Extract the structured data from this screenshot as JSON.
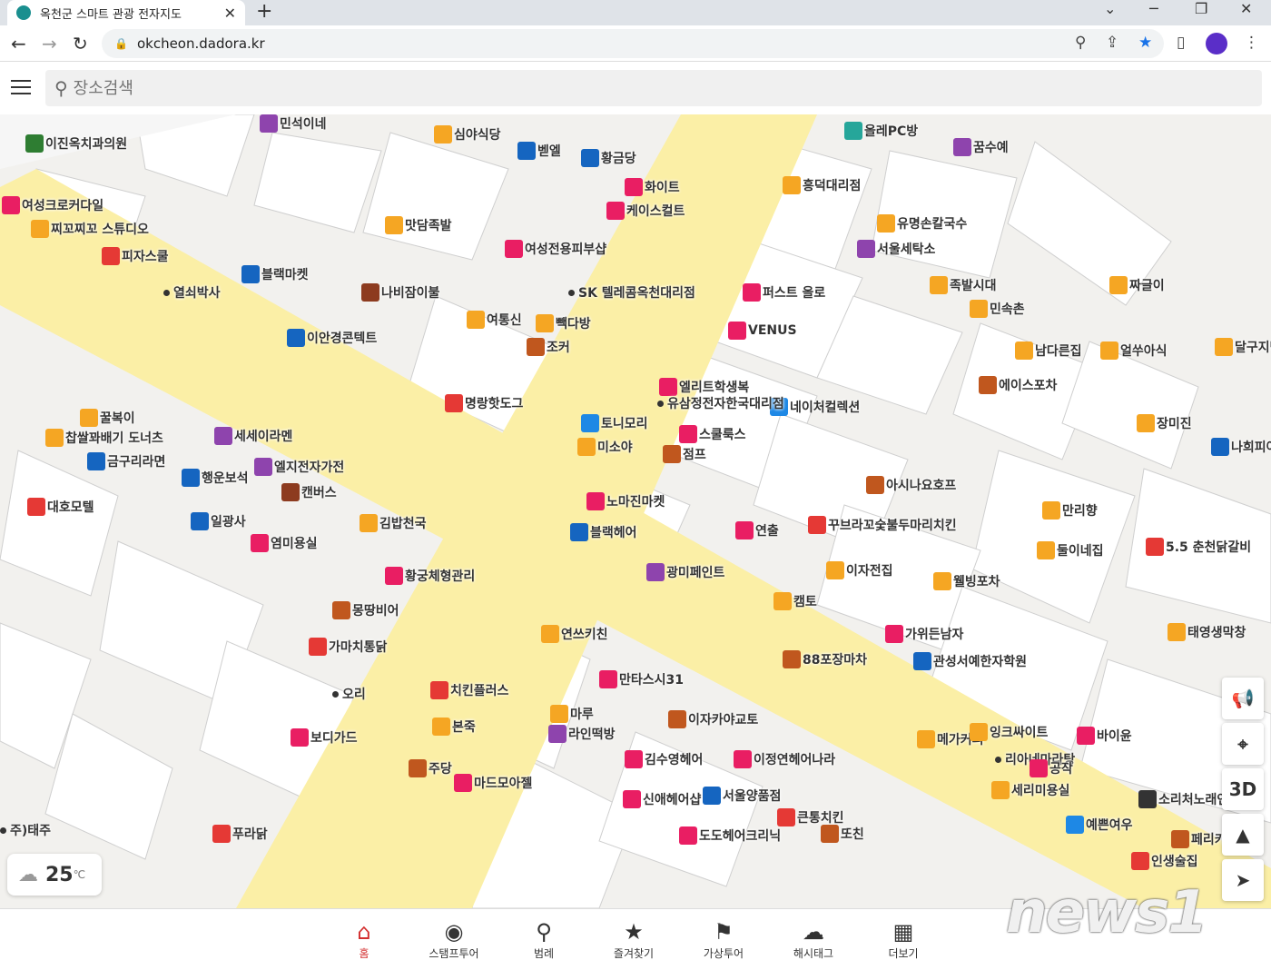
{
  "browser": {
    "tab_title": "옥천군 스마트 관광 전자지도",
    "url": "okcheon.dadora.kr"
  },
  "search": {
    "placeholder": "장소검색"
  },
  "weather": {
    "temperature": "25",
    "unit": "℃"
  },
  "map_controls": {
    "three_d": "3D"
  },
  "pois": [
    {
      "label": "이진옥치과의원",
      "color": "#2e7d32",
      "icon": "hospital-icon"
    },
    {
      "label": "민석이네",
      "color": "#8e44ad",
      "icon": "shop-icon"
    },
    {
      "label": "심야식당",
      "color": "#f5a623",
      "icon": "restaurant-icon"
    },
    {
      "label": "올레PC방",
      "color": "#26a69a",
      "icon": "pc-icon"
    },
    {
      "label": "벧엘",
      "color": "#1565c0",
      "icon": "building-icon"
    },
    {
      "label": "황금당",
      "color": "#1565c0",
      "icon": "shop-icon"
    },
    {
      "label": "화이트",
      "color": "#e91e63",
      "icon": "clothing-icon"
    },
    {
      "label": "케이스컬트",
      "color": "#e91e63",
      "icon": "clothing-icon"
    },
    {
      "label": "꿈수예",
      "color": "#8e44ad",
      "icon": "shop-icon"
    },
    {
      "label": "흥덕대리점",
      "color": "#f5a623",
      "icon": "shop-icon"
    },
    {
      "label": "여성크로커다일",
      "color": "#e91e63",
      "icon": "clothing-icon"
    },
    {
      "label": "찌꼬찌꼬 스튜디오",
      "color": "#f5a623",
      "icon": "studio-icon"
    },
    {
      "label": "피자스쿨",
      "color": "#e53935",
      "icon": "restaurant-icon"
    },
    {
      "label": "맛담족발",
      "color": "#f5a623",
      "icon": "restaurant-icon"
    },
    {
      "label": "여성전용피부샵",
      "color": "#e91e63",
      "icon": "beauty-icon"
    },
    {
      "label": "유명손칼국수",
      "color": "#f5a623",
      "icon": "restaurant-icon"
    },
    {
      "label": "서울세탁소",
      "color": "#8e44ad",
      "icon": "laundry-icon"
    },
    {
      "label": "짜글이",
      "color": "#f5a623",
      "icon": "restaurant-icon"
    },
    {
      "label": "블랙마켓",
      "color": "#1565c0",
      "icon": "shop-icon"
    },
    {
      "label": "열쇠박사",
      "color": "#333333",
      "icon": "dot-icon"
    },
    {
      "label": "나비잠이불",
      "color": "#8d3b1f",
      "icon": "bedding-icon"
    },
    {
      "label": "SK 텔레콤옥천대리점",
      "color": "#333333",
      "icon": "dot-icon"
    },
    {
      "label": "퍼스트 올로",
      "color": "#e91e63",
      "icon": "clothing-icon"
    },
    {
      "label": "VENUS",
      "color": "#e91e63",
      "icon": "clothing-icon"
    },
    {
      "label": "족발시대",
      "color": "#f5a623",
      "icon": "restaurant-icon"
    },
    {
      "label": "민속촌",
      "color": "#f5a623",
      "icon": "restaurant-icon"
    },
    {
      "label": "여통신",
      "color": "#f5a623",
      "icon": "phone-icon"
    },
    {
      "label": "빽다방",
      "color": "#f5a623",
      "icon": "cafe-icon"
    },
    {
      "label": "조커",
      "color": "#c0571e",
      "icon": "bar-icon"
    },
    {
      "label": "이안경콘텍트",
      "color": "#1565c0",
      "icon": "glasses-icon"
    },
    {
      "label": "남다른집",
      "color": "#f5a623",
      "icon": "restaurant-icon"
    },
    {
      "label": "얼쑤아식",
      "color": "#f5a623",
      "icon": "restaurant-icon"
    },
    {
      "label": "달구지막",
      "color": "#f5a623",
      "icon": "restaurant-icon"
    },
    {
      "label": "에이스포차",
      "color": "#c0571e",
      "icon": "bar-icon"
    },
    {
      "label": "장미진",
      "color": "#f5a623",
      "icon": "restaurant-icon"
    },
    {
      "label": "엘리트학생복",
      "color": "#e91e63",
      "icon": "clothing-icon"
    },
    {
      "label": "네이처컬렉션",
      "color": "#1e88e5",
      "icon": "cosmetics-icon"
    },
    {
      "label": "명랑핫도그",
      "color": "#e53935",
      "icon": "restaurant-icon"
    },
    {
      "label": "유삼정전자한국대리점",
      "color": "#333333",
      "icon": "dot-icon"
    },
    {
      "label": "토니모리",
      "color": "#1e88e5",
      "icon": "cosmetics-icon"
    },
    {
      "label": "스쿨룩스",
      "color": "#e91e63",
      "icon": "clothing-icon"
    },
    {
      "label": "미소야",
      "color": "#f5a623",
      "icon": "restaurant-icon"
    },
    {
      "label": "점프",
      "color": "#c0571e",
      "icon": "bar-icon"
    },
    {
      "label": "꿀복이",
      "color": "#f5a623",
      "icon": "shop-icon"
    },
    {
      "label": "찹쌀꽈배기 도너츠",
      "color": "#f5a623",
      "icon": "bakery-icon"
    },
    {
      "label": "세세이라멘",
      "color": "#8e44ad",
      "icon": "restaurant-icon"
    },
    {
      "label": "금구리라면",
      "color": "#1565c0",
      "icon": "restaurant-icon"
    },
    {
      "label": "엘지전자가전",
      "color": "#8e44ad",
      "icon": "electronics-icon"
    },
    {
      "label": "행운보석",
      "color": "#1565c0",
      "icon": "jewelry-icon"
    },
    {
      "label": "캔버스",
      "color": "#8d3b1f",
      "icon": "shop-icon"
    },
    {
      "label": "나희피아노",
      "color": "#1565c0",
      "icon": "piano-icon"
    },
    {
      "label": "아시나요호프",
      "color": "#c0571e",
      "icon": "bar-icon"
    },
    {
      "label": "노마진마켓",
      "color": "#e91e63",
      "icon": "shop-icon"
    },
    {
      "label": "블랙헤어",
      "color": "#1565c0",
      "icon": "hair-icon"
    },
    {
      "label": "대호모텔",
      "color": "#e53935",
      "icon": "motel-icon"
    },
    {
      "label": "일광사",
      "color": "#1565c0",
      "icon": "shop-icon"
    },
    {
      "label": "김밥천국",
      "color": "#f5a623",
      "icon": "restaurant-icon"
    },
    {
      "label": "만리향",
      "color": "#f5a623",
      "icon": "restaurant-icon"
    },
    {
      "label": "연출",
      "color": "#e91e63",
      "icon": "clothing-icon"
    },
    {
      "label": "꾸브라꼬숯불두마리치킨",
      "color": "#e53935",
      "icon": "chicken-icon"
    },
    {
      "label": "염미용실",
      "color": "#e91e63",
      "icon": "hair-icon"
    },
    {
      "label": "둘이네집",
      "color": "#f5a623",
      "icon": "restaurant-icon"
    },
    {
      "label": "5.5 춘천닭갈비",
      "color": "#e53935",
      "icon": "restaurant-icon"
    },
    {
      "label": "광미페인트",
      "color": "#8e44ad",
      "icon": "paint-icon"
    },
    {
      "label": "이자전집",
      "color": "#f5a623",
      "icon": "restaurant-icon"
    },
    {
      "label": "웰빙포차",
      "color": "#f5a623",
      "icon": "bar-icon"
    },
    {
      "label": "황궁체형관리",
      "color": "#e91e63",
      "icon": "beauty-icon"
    },
    {
      "label": "몽땅비어",
      "color": "#c0571e",
      "icon": "bar-icon"
    },
    {
      "label": "캠토",
      "color": "#f5a623",
      "icon": "restaurant-icon"
    },
    {
      "label": "태영생막창",
      "color": "#f5a623",
      "icon": "restaurant-icon"
    },
    {
      "label": "가마치통닭",
      "color": "#e53935",
      "icon": "chicken-icon"
    },
    {
      "label": "연쓰키친",
      "color": "#f5a623",
      "icon": "restaurant-icon"
    },
    {
      "label": "가위든남자",
      "color": "#e91e63",
      "icon": "hair-icon"
    },
    {
      "label": "88포장마차",
      "color": "#c0571e",
      "icon": "bar-icon"
    },
    {
      "label": "관성서예한자학원",
      "color": "#1565c0",
      "icon": "academy-icon"
    },
    {
      "label": "만타스시31",
      "color": "#e91e63",
      "icon": "restaurant-icon"
    },
    {
      "label": "치킨플러스",
      "color": "#e53935",
      "icon": "chicken-icon"
    },
    {
      "label": "오리",
      "color": "#333333",
      "icon": "dot-icon"
    },
    {
      "label": "마루",
      "color": "#f5a623",
      "icon": "restaurant-icon"
    },
    {
      "label": "라인떡방",
      "color": "#8e44ad",
      "icon": "bakery-icon"
    },
    {
      "label": "이자카야교토",
      "color": "#c0571e",
      "icon": "bar-icon"
    },
    {
      "label": "본죽",
      "color": "#f5a623",
      "icon": "restaurant-icon"
    },
    {
      "label": "메가커피",
      "color": "#f5a623",
      "icon": "cafe-icon"
    },
    {
      "label": "잉크싸이트",
      "color": "#f5a623",
      "icon": "shop-icon"
    },
    {
      "label": "바이윤",
      "color": "#e91e63",
      "icon": "clothing-icon"
    },
    {
      "label": "보디가드",
      "color": "#e91e63",
      "icon": "clothing-icon"
    },
    {
      "label": "김수영헤어",
      "color": "#e91e63",
      "icon": "hair-icon"
    },
    {
      "label": "이정연헤어나라",
      "color": "#e91e63",
      "icon": "hair-icon"
    },
    {
      "label": "리아네마라탕",
      "color": "#333333",
      "icon": "dot-icon"
    },
    {
      "label": "공작",
      "color": "#e91e63",
      "icon": "clothing-icon"
    },
    {
      "label": "주당",
      "color": "#c0571e",
      "icon": "bar-icon"
    },
    {
      "label": "마드모아젤",
      "color": "#e91e63",
      "icon": "clothing-icon"
    },
    {
      "label": "신애헤어샵",
      "color": "#e91e63",
      "icon": "hair-icon"
    },
    {
      "label": "서울양품점",
      "color": "#1565c0",
      "icon": "shop-icon"
    },
    {
      "label": "세리미용실",
      "color": "#f5a623",
      "icon": "hair-icon"
    },
    {
      "label": "소리처노래연습장",
      "color": "#333333",
      "icon": "karaoke-icon"
    },
    {
      "label": "큰통치킨",
      "color": "#e53935",
      "icon": "chicken-icon"
    },
    {
      "label": "또친",
      "color": "#c0571e",
      "icon": "bar-icon"
    },
    {
      "label": "예쁜여우",
      "color": "#1e88e5",
      "icon": "clothing-icon"
    },
    {
      "label": "페리카나",
      "color": "#c0571e",
      "icon": "chicken-icon"
    },
    {
      "label": "주)태주",
      "color": "#333333",
      "icon": "dot-icon"
    },
    {
      "label": "푸라닭",
      "color": "#e53935",
      "icon": "chicken-icon"
    },
    {
      "label": "도도헤어크리닉",
      "color": "#e91e63",
      "icon": "hair-icon"
    },
    {
      "label": "인생술집",
      "color": "#e53935",
      "icon": "bar-icon"
    }
  ],
  "bottom_nav": [
    {
      "label": "홈",
      "icon": "home-icon",
      "active": true
    },
    {
      "label": "스탬프투어",
      "icon": "stamp-icon"
    },
    {
      "label": "범례",
      "icon": "pin-icon"
    },
    {
      "label": "즐겨찾기",
      "icon": "star-icon"
    },
    {
      "label": "가상투어",
      "icon": "flag-icon"
    },
    {
      "label": "해시태그",
      "icon": "cloud-icon"
    },
    {
      "label": "더보기",
      "icon": "grid-icon"
    }
  ],
  "watermark": "news1"
}
